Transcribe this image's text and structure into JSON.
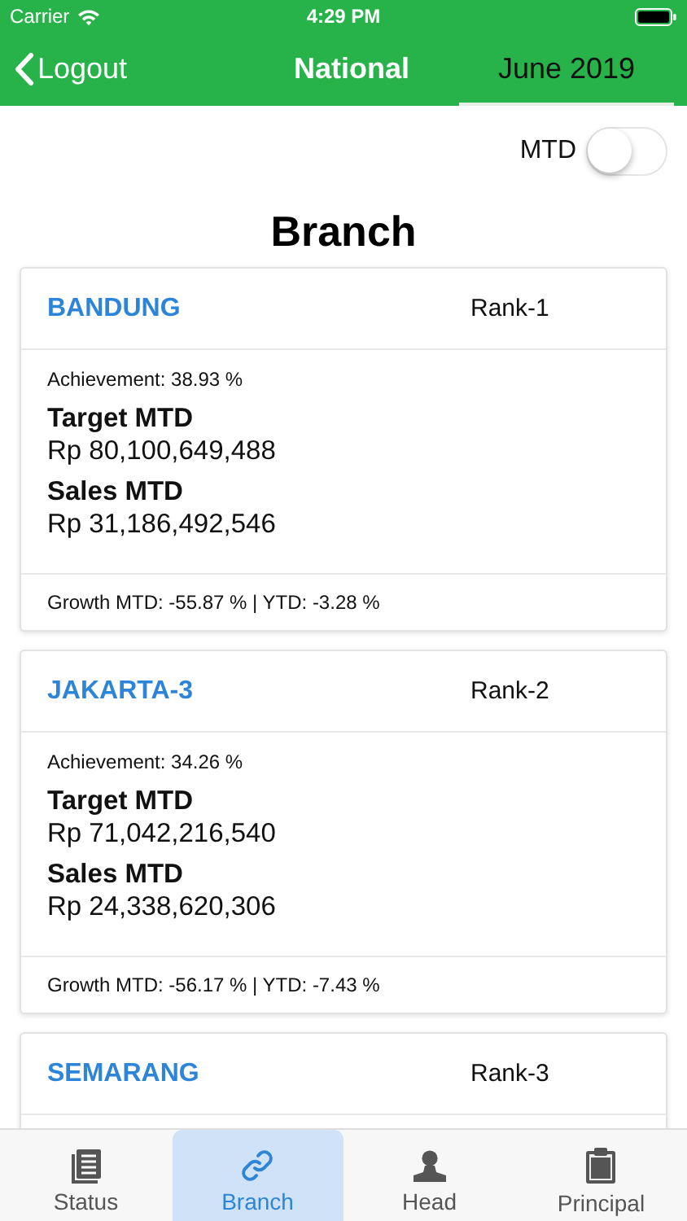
{
  "status_bar": {
    "carrier": "Carrier",
    "time": "4:29 PM"
  },
  "nav": {
    "back": "Logout",
    "title": "National",
    "period": "June 2019"
  },
  "filter": {
    "label": "MTD",
    "on": false
  },
  "heading": "Branch",
  "branches": [
    {
      "name": "BANDUNG",
      "rank": "Rank-1",
      "achievement": "Achievement: 38.93 %",
      "target_label": "Target MTD",
      "target": "Rp 80,100,649,488",
      "sales_label": "Sales MTD",
      "sales": "Rp 31,186,492,546",
      "growth": "Growth MTD: -55.87 % | YTD: -3.28 %"
    },
    {
      "name": "JAKARTA-3",
      "rank": "Rank-2",
      "achievement": "Achievement: 34.26 %",
      "target_label": "Target MTD",
      "target": "Rp 71,042,216,540",
      "sales_label": "Sales MTD",
      "sales": "Rp 24,338,620,306",
      "growth": "Growth MTD: -56.17 % | YTD: -7.43 %"
    },
    {
      "name": "SEMARANG",
      "rank": "Rank-3"
    }
  ],
  "tabs": [
    {
      "kind": "status",
      "label": "Status",
      "selected": false
    },
    {
      "kind": "branch",
      "label": "Branch",
      "selected": true
    },
    {
      "kind": "head",
      "label": "Head",
      "selected": false
    },
    {
      "kind": "principal",
      "label": "Principal",
      "selected": false
    }
  ]
}
